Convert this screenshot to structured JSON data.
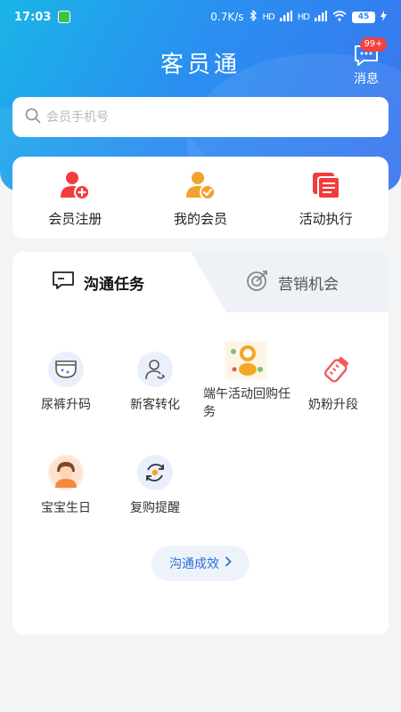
{
  "status_bar": {
    "time": "17:03",
    "network_speed": "0.7K/s",
    "signal1": "HD",
    "signal2": "HD",
    "battery": "45"
  },
  "header": {
    "title": "客员通",
    "message_label": "消息",
    "message_badge": "99+"
  },
  "search": {
    "placeholder": "会员手机号"
  },
  "quick_actions": [
    {
      "label": "会员注册",
      "icon": "user-add-icon"
    },
    {
      "label": "我的会员",
      "icon": "user-check-icon"
    },
    {
      "label": "活动执行",
      "icon": "activity-doc-icon"
    }
  ],
  "tabs": [
    {
      "label": "沟通任务",
      "icon": "chat-icon",
      "active": true
    },
    {
      "label": "营销机会",
      "icon": "target-icon",
      "active": false
    }
  ],
  "tasks": [
    {
      "label": "尿裤升码",
      "icon": "diaper-icon"
    },
    {
      "label": "新客转化",
      "icon": "user-convert-icon"
    },
    {
      "label": "端午活动回购任务",
      "icon": "duanwu-image-icon"
    },
    {
      "label": "奶粉升段",
      "icon": "milk-bottle-icon"
    },
    {
      "label": "宝宝生日",
      "icon": "baby-avatar-icon"
    },
    {
      "label": "复购提醒",
      "icon": "repurchase-icon"
    }
  ],
  "result_button": {
    "label": "沟通成效"
  },
  "colors": {
    "header_start": "#1ab5e8",
    "header_end": "#3a73ee",
    "accent_blue": "#2a6fd6",
    "icon_red": "#f23d3d",
    "icon_orange": "#f2a12a",
    "badge_red": "#f44040"
  }
}
